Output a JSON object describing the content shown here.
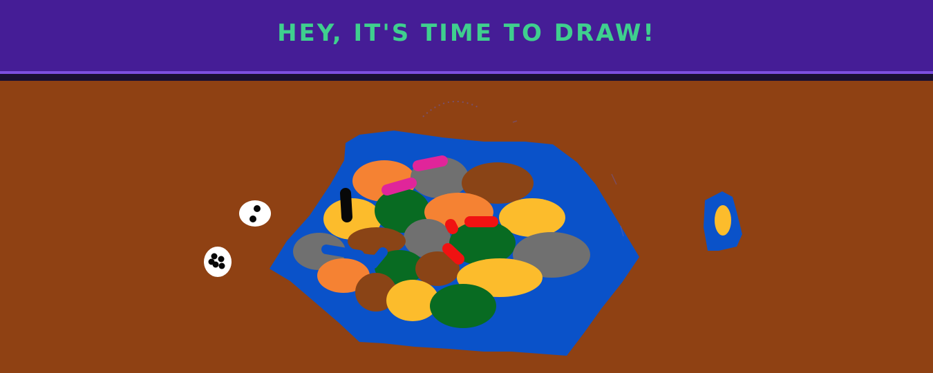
{
  "header": {
    "title": "HEY, IT'S TIME TO DRAW!"
  },
  "colors": {
    "header_bg": "#451d96",
    "header_line": "#7d4fe0",
    "title_text": "#3fcf8e",
    "canvas_bg": "#8f4113",
    "water": "#0a52c9",
    "orange": "#f58233",
    "gray": "#707070",
    "brown": "#8f4113",
    "green": "#086b22",
    "yellow": "#fcbc2c",
    "pink": "#e0259a",
    "red": "#f01212",
    "black": "#080808",
    "white": "#ffffff"
  },
  "canvas": {
    "description_icon": "drawing-canvas"
  }
}
